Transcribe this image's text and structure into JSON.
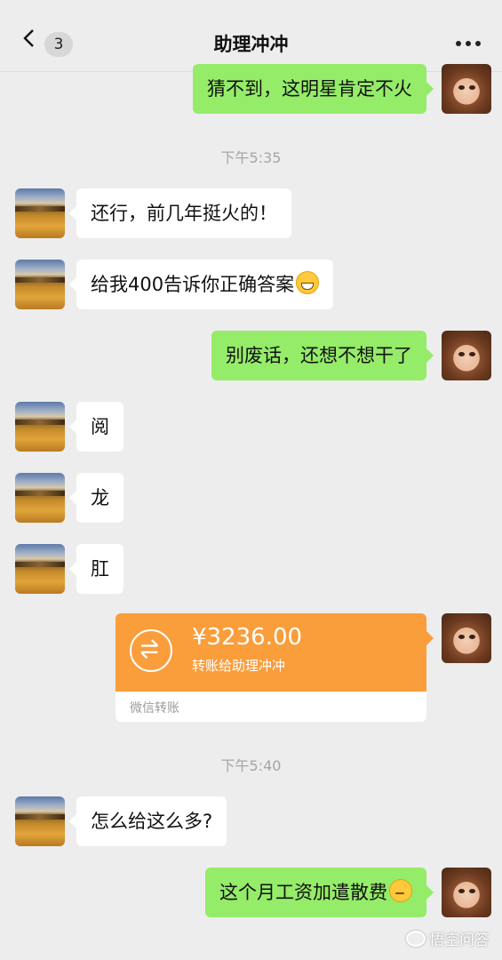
{
  "header": {
    "unread_count": "3",
    "title": "助理冲冲"
  },
  "messages": [
    {
      "side": "right",
      "text": "猜不到，这明星肯定不火"
    },
    {
      "side": "left",
      "text": "还行，前几年挺火的！"
    },
    {
      "side": "left",
      "text": "给我400告诉你正确答案",
      "emoji": "grin-icon"
    },
    {
      "side": "right",
      "text": "别废话，还想不想干了"
    },
    {
      "side": "left",
      "text": "阅"
    },
    {
      "side": "left",
      "text": "龙"
    },
    {
      "side": "left",
      "text": "肛"
    },
    {
      "side": "left",
      "text": "怎么给这么多?"
    },
    {
      "side": "right",
      "text": "这个月工资加遣散费",
      "emoji": "thinking-icon"
    }
  ],
  "timestamps": [
    "下午5:35",
    "下午5:40"
  ],
  "transfer": {
    "amount": "¥3236.00",
    "description": "转账给助理冲冲",
    "footer": "微信转账",
    "color": "#fa9d3b"
  },
  "watermark": {
    "text": "悟空问答"
  },
  "colors": {
    "background": "#ededed",
    "sent_bubble": "#95ec69",
    "received_bubble": "#ffffff",
    "timestamp_text": "#a6a6a6"
  }
}
